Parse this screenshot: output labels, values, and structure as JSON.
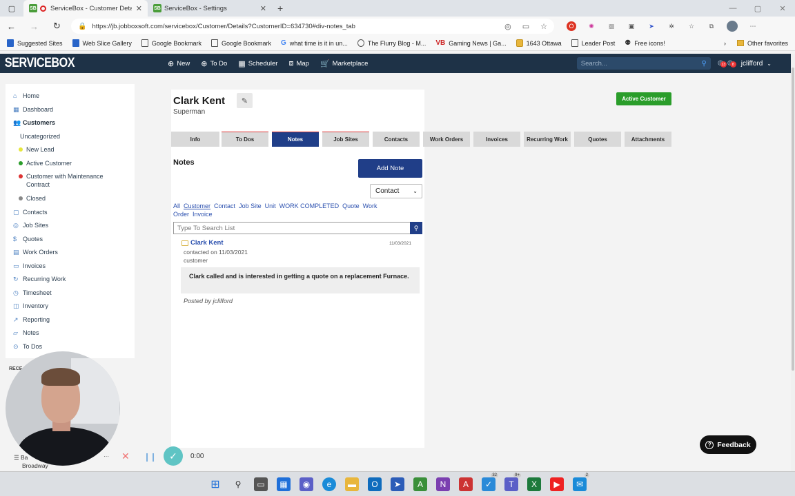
{
  "browser": {
    "tabs": [
      {
        "title": "ServiceBox - Customer Details",
        "active": true
      },
      {
        "title": "ServiceBox - Settings",
        "active": false
      }
    ],
    "url": "https://jb.jobboxsoft.com/servicebox/Customer/Details?CustomerID=634730#div-notes_tab",
    "bookmarks": [
      {
        "label": "Suggested Sites",
        "icon": "bing"
      },
      {
        "label": "Web Slice Gallery",
        "icon": "bing"
      },
      {
        "label": "Google Bookmark",
        "icon": "page"
      },
      {
        "label": "Google Bookmark",
        "icon": "page"
      },
      {
        "label": "what time is it in un...",
        "icon": "google"
      },
      {
        "label": "The Flurry Blog - M...",
        "icon": "page"
      },
      {
        "label": "Gaming News | Ga...",
        "icon": "vb"
      },
      {
        "label": "1643 Ottawa",
        "icon": "folder"
      },
      {
        "label": "Leader Post",
        "icon": "page"
      },
      {
        "label": "Free icons!",
        "icon": "page"
      }
    ],
    "other_favorites": "Other favorites"
  },
  "appnav": {
    "logo": "SERVICEBOX",
    "items": [
      "New",
      "To Do",
      "Scheduler",
      "Map",
      "Marketplace"
    ],
    "search_placeholder": "Search...",
    "badge1": "13",
    "badge2": "8",
    "user": "jclifford"
  },
  "sidebar": {
    "items": [
      {
        "label": "Home",
        "icon": "home-icon"
      },
      {
        "label": "Dashboard",
        "icon": "dashboard-icon"
      },
      {
        "label": "Customers",
        "icon": "users-icon",
        "bold": true
      },
      {
        "label": "Uncategorized",
        "sub": true
      },
      {
        "label": "New Lead",
        "sub": true,
        "dot": "#e6e63c"
      },
      {
        "label": "Active Customer",
        "sub": true,
        "dot": "#2a9d2a"
      },
      {
        "label": "Customer with Maintenance Contract",
        "sub": true,
        "dot": "#d33"
      },
      {
        "label": "Closed",
        "sub": true,
        "dot": "#888"
      },
      {
        "label": "Contacts",
        "icon": "contacts-icon"
      },
      {
        "label": "Job Sites",
        "icon": "location-icon"
      },
      {
        "label": "Quotes",
        "icon": "dollar-icon"
      },
      {
        "label": "Work Orders",
        "icon": "document-icon"
      },
      {
        "label": "Invoices",
        "icon": "invoice-icon"
      },
      {
        "label": "Recurring Work",
        "icon": "recurring-icon"
      },
      {
        "label": "Timesheet",
        "icon": "timesheet-icon"
      },
      {
        "label": "Inventory",
        "icon": "inventory-icon"
      },
      {
        "label": "Reporting",
        "icon": "reporting-icon"
      },
      {
        "label": "Notes",
        "icon": "notes-icon"
      },
      {
        "label": "To Dos",
        "icon": "todo-icon"
      }
    ],
    "recent_heading": "RECE",
    "recent_item_1": "Ba",
    "recent_item_2": "'s",
    "recent_item_3": "Broadway"
  },
  "customer": {
    "name": "Clark Kent",
    "subtitle": "Superman",
    "status_button": "Active Customer"
  },
  "tabs": [
    {
      "label": "Info",
      "style": "normal"
    },
    {
      "label": "To Dos",
      "style": "red"
    },
    {
      "label": "Notes",
      "style": "active"
    },
    {
      "label": "Job Sites",
      "style": "red"
    },
    {
      "label": "Contacts",
      "style": "normal"
    },
    {
      "label": "Work Orders",
      "style": "normal"
    },
    {
      "label": "Invoices",
      "style": "normal"
    },
    {
      "label": "Recurring Work",
      "style": "normal"
    },
    {
      "label": "Quotes",
      "style": "normal"
    },
    {
      "label": "Attachments",
      "style": "normal"
    }
  ],
  "notes": {
    "title": "Notes",
    "add_button": "Add Note",
    "select_value": "Contact",
    "filters": [
      "All",
      "Customer",
      "Contact",
      "Job Site",
      "Unit",
      "WORK COMPLETED",
      "Quote",
      "Work Order",
      "Invoice"
    ],
    "search_placeholder": "Type To Search List",
    "items": [
      {
        "author": "Clark Kent",
        "date": "11/03/2021",
        "contacted": "contacted on 11/03/2021",
        "type": "customer",
        "body": "Clark called and is interested in getting a quote on a replacement Furnace.",
        "posted": "Posted by jclifford"
      }
    ]
  },
  "feedback": "Feedback",
  "recorder": {
    "time": "0:00"
  },
  "taskbar_badges": {
    "a": "32",
    "b": "9+",
    "c": "2"
  }
}
